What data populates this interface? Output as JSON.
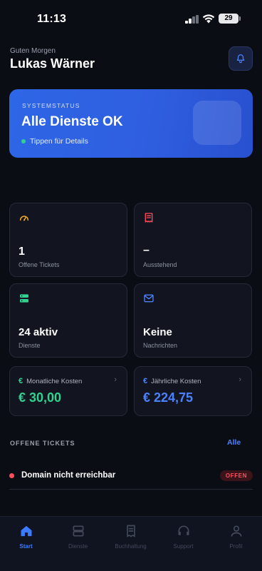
{
  "status_bar": {
    "time": "11:13",
    "battery": "29"
  },
  "header": {
    "greeting": "Guten Morgen",
    "user_name": "Lukas Wärner",
    "notification_icon": "bell-icon"
  },
  "status_card": {
    "eyebrow": "SYSTEMSTATUS",
    "headline": "Alle Dienste OK",
    "sub": "Tippen für Details",
    "indicator_color": "#2fd38f"
  },
  "stats": {
    "tickets": {
      "value": "1",
      "label": "Offene Tickets",
      "icon": "gauge-icon",
      "icon_color": "#f5a524"
    },
    "pending": {
      "value": "–",
      "label": "Ausstehend",
      "icon": "receipt-icon",
      "icon_color": "#ff4d5e"
    },
    "services": {
      "value": "24 aktiv",
      "label": "Dienste",
      "icon": "server-icon",
      "icon_color": "#2fd38f"
    },
    "messages": {
      "value": "Keine",
      "label": "Nachrichten",
      "icon": "mail-icon",
      "icon_color": "#4a82ff"
    }
  },
  "costs": {
    "monthly": {
      "label": "Monatliche Kosten",
      "value": "€ 30,00",
      "color": "#2fd38f",
      "icon": "euro-icon"
    },
    "yearly": {
      "label": "Jährliche Kosten",
      "value": "€ 224,75",
      "color": "#4a82ff",
      "icon": "euro-icon"
    }
  },
  "tickets_section": {
    "title": "OFFENE TICKETS",
    "link": "Alle",
    "items": [
      {
        "title": "Domain nicht erreichbar",
        "badge": "OFFEN",
        "status_color": "#ff4d5e"
      }
    ]
  },
  "tab_bar": {
    "active": "Start",
    "tabs": [
      {
        "label": "Start",
        "icon": "home-icon"
      },
      {
        "label": "Dienste",
        "icon": "server-icon"
      },
      {
        "label": "Buchhaltung",
        "icon": "receipt-icon"
      },
      {
        "label": "Support",
        "icon": "headset-icon"
      },
      {
        "label": "Profil",
        "icon": "user-icon"
      }
    ]
  }
}
